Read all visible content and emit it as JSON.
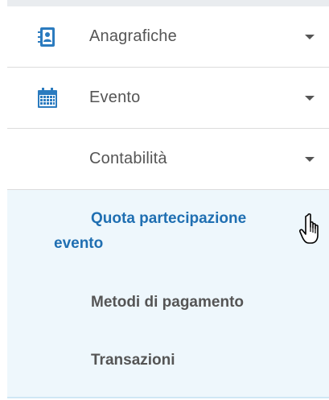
{
  "menu": {
    "items": [
      {
        "label": "Anagrafiche",
        "icon": "address-book-icon"
      },
      {
        "label": "Evento",
        "icon": "calendar-icon"
      },
      {
        "label": "Contabilità",
        "icon": ""
      }
    ]
  },
  "submenu": {
    "items": [
      {
        "label_line1": "Quota partecipazione",
        "label_line2": "evento",
        "active": true
      },
      {
        "label": "Metodi di pagamento",
        "active": false
      },
      {
        "label": "Transazioni",
        "active": false
      }
    ]
  },
  "colors": {
    "accent": "#1f6fb2",
    "icon_blue": "#2b7bbf",
    "submenu_bg": "#eef7fc",
    "text": "#555555"
  }
}
